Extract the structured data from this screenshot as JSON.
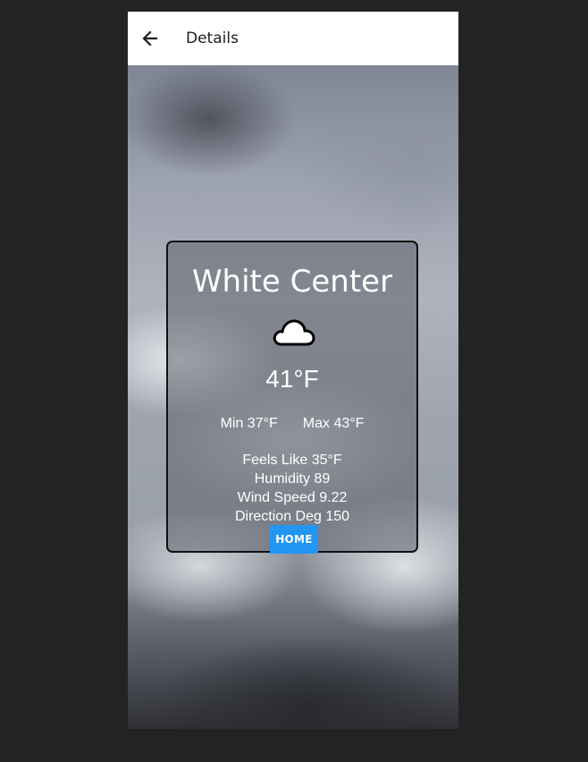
{
  "appbar": {
    "back_icon": "arrow-left-icon",
    "title": "Details"
  },
  "weather": {
    "city": "White Center",
    "condition_icon": "cloud-icon",
    "temperature": "41°F",
    "min": "Min 37°F",
    "max": "Max 43°F",
    "feels_like": "Feels Like 35°F",
    "humidity": "Humidity 89",
    "wind_speed": "Wind Speed 9.22",
    "direction": "Direction Deg 150"
  },
  "home_button": {
    "label": "HOME",
    "color": "#2196f3"
  }
}
